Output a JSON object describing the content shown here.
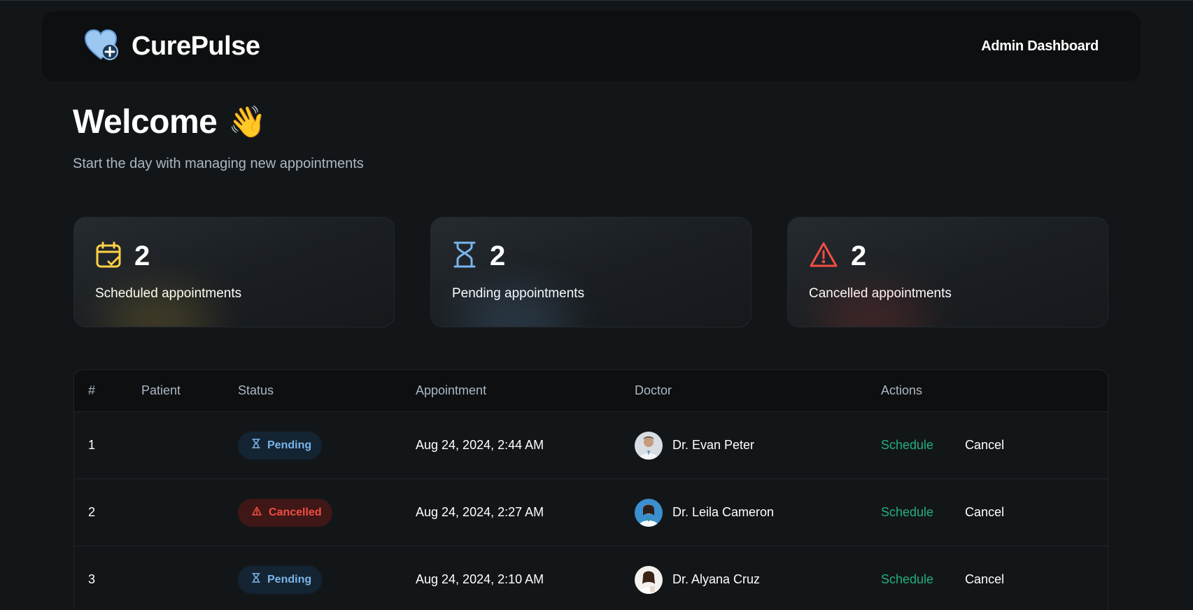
{
  "header": {
    "brand": "CurePulse",
    "title": "Admin Dashboard",
    "logo_icon": "heart-plus-icon"
  },
  "welcome": {
    "title": "Welcome",
    "emoji": "👋",
    "subtitle": "Start the day with managing new appointments"
  },
  "stats": [
    {
      "count": "2",
      "label": "Scheduled appointments",
      "icon": "calendar-check-icon",
      "color": "#ffd147"
    },
    {
      "count": "2",
      "label": "Pending appointments",
      "icon": "hourglass-icon",
      "color": "#79b5ec"
    },
    {
      "count": "2",
      "label": "Cancelled appointments",
      "icon": "alert-triangle-icon",
      "color": "#f24e43"
    }
  ],
  "table": {
    "columns": [
      "#",
      "Patient",
      "Status",
      "Appointment",
      "Doctor",
      "Actions"
    ],
    "rows": [
      {
        "num": "1",
        "patient": "",
        "status": "Pending",
        "appointment": "Aug 24, 2024, 2:44 AM",
        "doctor": "Dr. Evan Peter",
        "schedule": "Schedule",
        "cancel": "Cancel"
      },
      {
        "num": "2",
        "patient": "",
        "status": "Cancelled",
        "appointment": "Aug 24, 2024, 2:27 AM",
        "doctor": "Dr. Leila Cameron",
        "schedule": "Schedule",
        "cancel": "Cancel"
      },
      {
        "num": "3",
        "patient": "",
        "status": "Pending",
        "appointment": "Aug 24, 2024, 2:10 AM",
        "doctor": "Dr. Alyana Cruz",
        "schedule": "Schedule",
        "cancel": "Cancel"
      }
    ]
  },
  "colors": {
    "background": "#131619",
    "panel": "#0d0f10",
    "success": "#24ae7c",
    "pending": "#79b5ec",
    "danger": "#f24e43",
    "scheduled": "#ffd147"
  }
}
